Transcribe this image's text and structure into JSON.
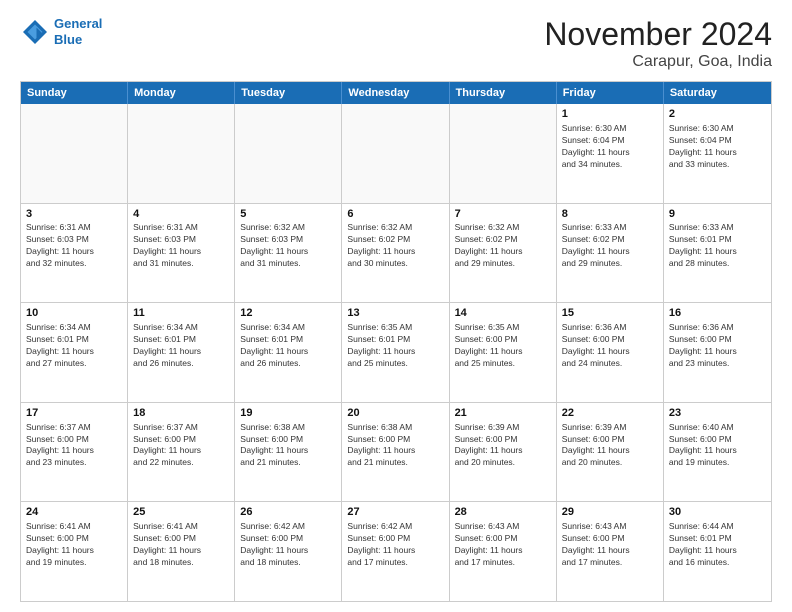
{
  "header": {
    "logo_line1": "General",
    "logo_line2": "Blue",
    "title": "November 2024",
    "subtitle": "Carapur, Goa, India"
  },
  "weekdays": [
    "Sunday",
    "Monday",
    "Tuesday",
    "Wednesday",
    "Thursday",
    "Friday",
    "Saturday"
  ],
  "rows": [
    [
      {
        "day": "",
        "info": ""
      },
      {
        "day": "",
        "info": ""
      },
      {
        "day": "",
        "info": ""
      },
      {
        "day": "",
        "info": ""
      },
      {
        "day": "",
        "info": ""
      },
      {
        "day": "1",
        "info": "Sunrise: 6:30 AM\nSunset: 6:04 PM\nDaylight: 11 hours\nand 34 minutes."
      },
      {
        "day": "2",
        "info": "Sunrise: 6:30 AM\nSunset: 6:04 PM\nDaylight: 11 hours\nand 33 minutes."
      }
    ],
    [
      {
        "day": "3",
        "info": "Sunrise: 6:31 AM\nSunset: 6:03 PM\nDaylight: 11 hours\nand 32 minutes."
      },
      {
        "day": "4",
        "info": "Sunrise: 6:31 AM\nSunset: 6:03 PM\nDaylight: 11 hours\nand 31 minutes."
      },
      {
        "day": "5",
        "info": "Sunrise: 6:32 AM\nSunset: 6:03 PM\nDaylight: 11 hours\nand 31 minutes."
      },
      {
        "day": "6",
        "info": "Sunrise: 6:32 AM\nSunset: 6:02 PM\nDaylight: 11 hours\nand 30 minutes."
      },
      {
        "day": "7",
        "info": "Sunrise: 6:32 AM\nSunset: 6:02 PM\nDaylight: 11 hours\nand 29 minutes."
      },
      {
        "day": "8",
        "info": "Sunrise: 6:33 AM\nSunset: 6:02 PM\nDaylight: 11 hours\nand 29 minutes."
      },
      {
        "day": "9",
        "info": "Sunrise: 6:33 AM\nSunset: 6:01 PM\nDaylight: 11 hours\nand 28 minutes."
      }
    ],
    [
      {
        "day": "10",
        "info": "Sunrise: 6:34 AM\nSunset: 6:01 PM\nDaylight: 11 hours\nand 27 minutes."
      },
      {
        "day": "11",
        "info": "Sunrise: 6:34 AM\nSunset: 6:01 PM\nDaylight: 11 hours\nand 26 minutes."
      },
      {
        "day": "12",
        "info": "Sunrise: 6:34 AM\nSunset: 6:01 PM\nDaylight: 11 hours\nand 26 minutes."
      },
      {
        "day": "13",
        "info": "Sunrise: 6:35 AM\nSunset: 6:01 PM\nDaylight: 11 hours\nand 25 minutes."
      },
      {
        "day": "14",
        "info": "Sunrise: 6:35 AM\nSunset: 6:00 PM\nDaylight: 11 hours\nand 25 minutes."
      },
      {
        "day": "15",
        "info": "Sunrise: 6:36 AM\nSunset: 6:00 PM\nDaylight: 11 hours\nand 24 minutes."
      },
      {
        "day": "16",
        "info": "Sunrise: 6:36 AM\nSunset: 6:00 PM\nDaylight: 11 hours\nand 23 minutes."
      }
    ],
    [
      {
        "day": "17",
        "info": "Sunrise: 6:37 AM\nSunset: 6:00 PM\nDaylight: 11 hours\nand 23 minutes."
      },
      {
        "day": "18",
        "info": "Sunrise: 6:37 AM\nSunset: 6:00 PM\nDaylight: 11 hours\nand 22 minutes."
      },
      {
        "day": "19",
        "info": "Sunrise: 6:38 AM\nSunset: 6:00 PM\nDaylight: 11 hours\nand 21 minutes."
      },
      {
        "day": "20",
        "info": "Sunrise: 6:38 AM\nSunset: 6:00 PM\nDaylight: 11 hours\nand 21 minutes."
      },
      {
        "day": "21",
        "info": "Sunrise: 6:39 AM\nSunset: 6:00 PM\nDaylight: 11 hours\nand 20 minutes."
      },
      {
        "day": "22",
        "info": "Sunrise: 6:39 AM\nSunset: 6:00 PM\nDaylight: 11 hours\nand 20 minutes."
      },
      {
        "day": "23",
        "info": "Sunrise: 6:40 AM\nSunset: 6:00 PM\nDaylight: 11 hours\nand 19 minutes."
      }
    ],
    [
      {
        "day": "24",
        "info": "Sunrise: 6:41 AM\nSunset: 6:00 PM\nDaylight: 11 hours\nand 19 minutes."
      },
      {
        "day": "25",
        "info": "Sunrise: 6:41 AM\nSunset: 6:00 PM\nDaylight: 11 hours\nand 18 minutes."
      },
      {
        "day": "26",
        "info": "Sunrise: 6:42 AM\nSunset: 6:00 PM\nDaylight: 11 hours\nand 18 minutes."
      },
      {
        "day": "27",
        "info": "Sunrise: 6:42 AM\nSunset: 6:00 PM\nDaylight: 11 hours\nand 17 minutes."
      },
      {
        "day": "28",
        "info": "Sunrise: 6:43 AM\nSunset: 6:00 PM\nDaylight: 11 hours\nand 17 minutes."
      },
      {
        "day": "29",
        "info": "Sunrise: 6:43 AM\nSunset: 6:00 PM\nDaylight: 11 hours\nand 17 minutes."
      },
      {
        "day": "30",
        "info": "Sunrise: 6:44 AM\nSunset: 6:01 PM\nDaylight: 11 hours\nand 16 minutes."
      }
    ]
  ]
}
